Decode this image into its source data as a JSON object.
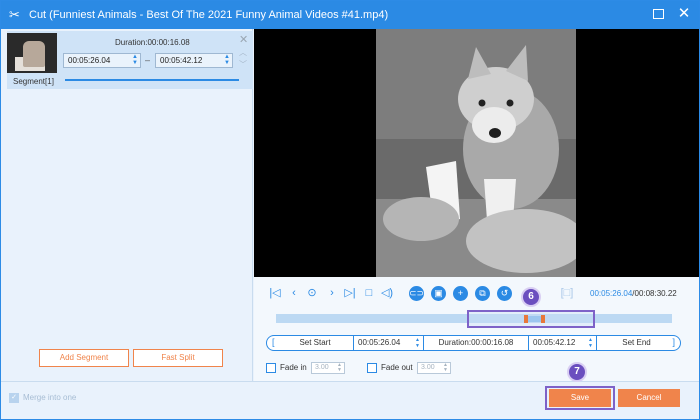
{
  "window": {
    "title": "Cut (Funniest Animals - Best Of The 2021 Funny Animal Videos #41.mp4)",
    "accent": "#2b8ae4",
    "action_color": "#f0844b",
    "highlight_color": "#7e62c8"
  },
  "segment": {
    "label": "Segment[1]",
    "duration": "Duration:00:00:16.08",
    "start": "00:05:26.04",
    "separator": "–",
    "end": "00:05:42.12"
  },
  "left_buttons": {
    "add_segment": "Add Segment",
    "fast_split": "Fast Split"
  },
  "player": {
    "current_time": "00:05:26.04",
    "total_time": "/00:08:30.22",
    "icons": [
      "to-start-icon",
      "prev-frame-icon",
      "play-icon",
      "next-frame-icon",
      "to-end-icon",
      "stop-icon",
      "volume-icon",
      "split-icon",
      "snapshot-icon",
      "add-segment-icon",
      "copy-icon",
      "undo-icon"
    ]
  },
  "trim": {
    "set_start": "Set Start",
    "start_value": "00:05:26.04",
    "duration": "Duration:00:00:16.08",
    "end_value": "00:05:42.12",
    "set_end": "Set End"
  },
  "fade": {
    "fade_in_label": "Fade in",
    "fade_in_value": "3.00",
    "fade_out_label": "Fade out",
    "fade_out_value": "3.00"
  },
  "footer": {
    "merge_label": "Merge into one",
    "save": "Save",
    "cancel": "Cancel"
  },
  "steps": {
    "six": "6",
    "seven": "7"
  }
}
